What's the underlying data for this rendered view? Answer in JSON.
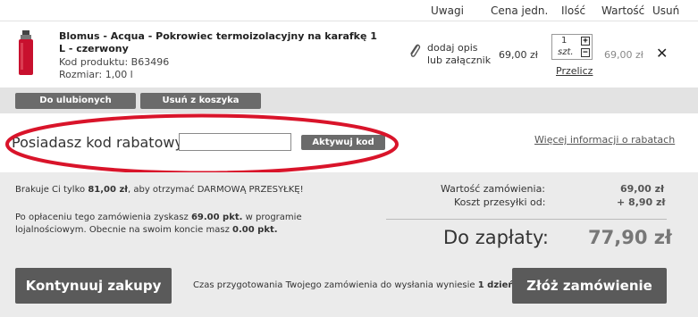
{
  "columns": {
    "notes": "Uwagi",
    "unit_price": "Cena jedn.",
    "quantity": "Ilość",
    "value": "Wartość",
    "remove": "Usuń"
  },
  "product": {
    "name": "Blomus - Acqua - Pokrowiec termoizolacyjny na karafkę 1 L - czerwony",
    "code": "Kod produktu: B63496",
    "size": "Rozmiar: 1,00 l",
    "add_desc_line1": "dodaj opis",
    "add_desc_line2": "lub załącznik",
    "unit_price": "69,00 zł",
    "quantity": "1",
    "unit": "szt.",
    "recalculate": "Przelicz",
    "value": "69,00 zł",
    "remove_symbol": "✕",
    "image_color": "#c8102e"
  },
  "toolbar": {
    "favorites": "Do ulubionych",
    "remove_from_cart": "Usuń z koszyka"
  },
  "discount": {
    "label": "Posiadasz kod rabatowy?",
    "input_value": "",
    "activate": "Aktywuj kod",
    "more_info": "Więcej informacji o rabatach",
    "highlight_color": "#d9142a"
  },
  "shipping_note": {
    "prefix": "Brakuje Ci tylko ",
    "amount": "81,00 zł",
    "suffix": ", aby otrzymać DARMOWĄ PRZESYŁKĘ!"
  },
  "loyalty_note": {
    "part1": "Po opłaceniu tego zamówienia zyskasz ",
    "points_gain": "69.00 pkt.",
    "part2": " w programie",
    "line2_prefix": "lojalnościowym. Obecnie na swoim koncie masz ",
    "points_current": "0.00 pkt."
  },
  "summary": {
    "order_value_label": "Wartość zamówienia:",
    "order_value": "69,00 zł",
    "shipping_label": "Koszt przesyłki od:",
    "shipping_value": "+ 8,90 zł",
    "total_label": "Do zapłaty:",
    "total_value": "77,90 zł"
  },
  "footer": {
    "continue": "Kontynuuj zakupy",
    "prep_prefix": "Czas przygotowania Twojego zamówienia do wysłania wyniesie ",
    "prep_days": "1 dzień",
    "place_order": "Złóż zamówienie"
  }
}
